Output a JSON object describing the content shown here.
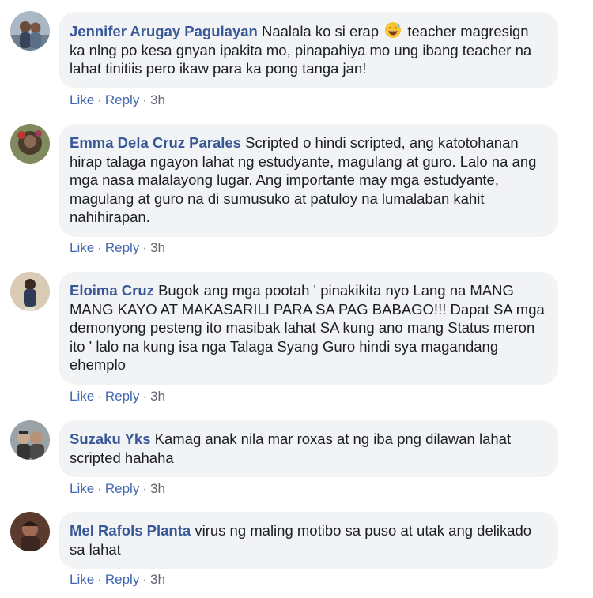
{
  "comments": [
    {
      "author": "Jennifer Arugay Pagulayan",
      "text_before_emoji": "Naalala ko si erap",
      "emoji": "grinning-sweat-emoji",
      "text": "teacher magresign ka nlng po kesa gnyan ipakita mo, pinapahiya mo ung ibang teacher na lahat tinitiis pero ikaw para ka pong tanga jan!",
      "like": "Like",
      "reply": "Reply",
      "time": "3h"
    },
    {
      "author": "Emma Dela Cruz Parales",
      "text": "Scripted o hindi scripted, ang katotohanan hirap talaga ngayon lahat ng estudyante, magulang at guro. Lalo na ang mga nasa malalayong lugar. Ang importante may mga estudyante, magulang at guro na di sumusuko at patuloy na lumalaban kahit nahihirapan.",
      "like": "Like",
      "reply": "Reply",
      "time": "3h"
    },
    {
      "author": "Eloima Cruz",
      "text": "Bugok ang mga pootah ' pinakikita nyo Lang na MANG MANG KAYO AT MAKASARILI PARA SA PAG BABAGO!!! Dapat SA mga demonyong pesteng ito masibak lahat SA kung ano mang Status meron ito ' lalo na kung isa nga Talaga Syang Guro hindi sya magandang ehemplo",
      "like": "Like",
      "reply": "Reply",
      "time": "3h"
    },
    {
      "author": "Suzaku Yks",
      "text": "Kamag anak nila mar roxas at ng iba png dilawan lahat scripted hahaha",
      "like": "Like",
      "reply": "Reply",
      "time": "3h"
    },
    {
      "author": "Mel Rafols Planta",
      "text": "virus ng maling motibo sa puso at utak ang delikado sa lahat",
      "like": "Like",
      "reply": "Reply",
      "time": "3h"
    }
  ],
  "colors": {
    "bubble": "#f2f3f5",
    "author": "#385898",
    "action": "#4267b2",
    "meta": "#606770"
  }
}
